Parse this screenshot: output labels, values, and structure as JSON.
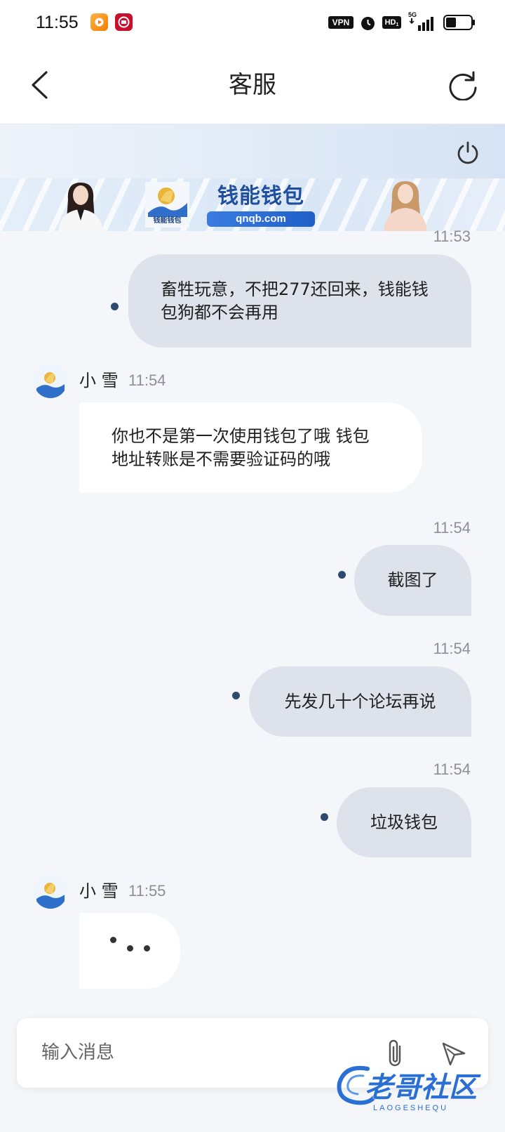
{
  "status_bar": {
    "time": "11:55",
    "vpn": "VPN",
    "hd": "HD",
    "hd_sub": "1",
    "network": "5G",
    "icons": [
      "video-app-icon",
      "red-app-icon",
      "alarm-icon",
      "signal-icon",
      "battery-icon"
    ]
  },
  "header": {
    "title": "客服",
    "back_icon": "chevron-left-icon",
    "refresh_icon": "refresh-icon"
  },
  "toolbar": {
    "power_icon": "power-icon"
  },
  "banner": {
    "brand": "钱能钱包",
    "url": "qnqb.com",
    "logo_caption": "钱能钱包"
  },
  "messages": [
    {
      "direction": "outgoing",
      "time": "11:53",
      "lines": [
        "畜牲玩意，不把277还回来，钱能钱",
        "包狗都不会再用"
      ]
    },
    {
      "direction": "incoming",
      "sender": "小 雪",
      "time": "11:54",
      "lines": [
        "你也不是第一次使用钱包了哦 钱包",
        "地址转账是不需要验证码的哦"
      ]
    },
    {
      "direction": "outgoing",
      "time": "11:54",
      "lines": [
        "截图了"
      ]
    },
    {
      "direction": "outgoing",
      "time": "11:54",
      "lines": [
        "先发几十个论坛再说"
      ]
    },
    {
      "direction": "outgoing",
      "time": "11:54",
      "lines": [
        "垃圾钱包"
      ]
    },
    {
      "direction": "incoming",
      "sender": "小 雪",
      "time": "11:55",
      "icon": "typing-dots-icon"
    }
  ],
  "input": {
    "placeholder": "输入消息",
    "attach_icon": "paperclip-icon",
    "send_icon": "send-icon"
  },
  "watermark": {
    "text": "老哥社区",
    "subtext": "LAOGESHEQU"
  },
  "colors": {
    "background": "#f4f6f9",
    "outgoing_bubble": "#dee2ea",
    "incoming_bubble": "#ffffff",
    "read_dot": "#2c4a6e",
    "brand_blue": "#1f5fc8"
  }
}
